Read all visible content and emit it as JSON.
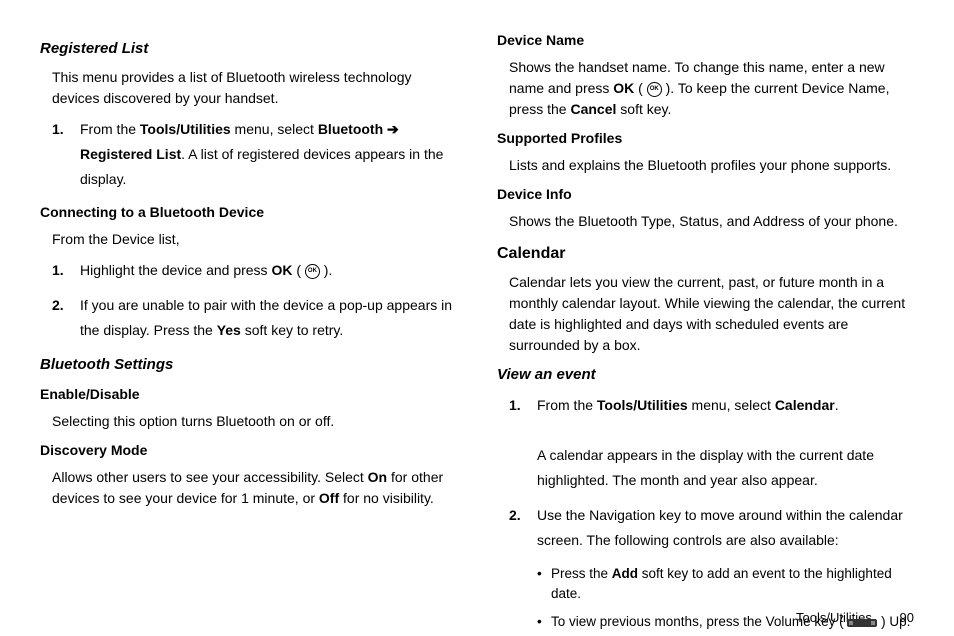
{
  "left": {
    "h1": "Registered List",
    "p1": "This menu provides a list of Bluetooth wireless technology devices discovered by your handset.",
    "list1": {
      "num": "1.",
      "pre": "From the ",
      "b1": "Tools/Utilities",
      "mid1": " menu, select ",
      "b2": "Bluetooth",
      "arrow": " ➔ ",
      "b3": "Registered List",
      "post": ". A list of registered devices appears in the display."
    },
    "h2": "Connecting to a Bluetooth Device",
    "p2": "From the Device list,",
    "list2a": {
      "num": "1.",
      "pre": "Highlight the device and press ",
      "b1": "OK",
      "mid1": " ( ",
      "post": " )."
    },
    "list2b": {
      "num": "2.",
      "pre": "If you are unable to pair with the device a pop-up appears in the display. Press the ",
      "b1": "Yes",
      "post": " soft key to retry."
    },
    "h3": "Bluetooth Settings",
    "h4": "Enable/Disable",
    "p3": "Selecting this option turns Bluetooth on or off.",
    "h5": "Discovery Mode",
    "p4pre": "Allows other users to see your accessibility. Select ",
    "p4b1": "On",
    "p4mid": " for other devices to see your device for 1 minute, or ",
    "p4b2": "Off",
    "p4post": " for no visibility."
  },
  "right": {
    "h6": "Device Name",
    "p5pre": "Shows the handset name. To change this name, enter a new name and press ",
    "p5b1": "OK",
    "p5mid1": " ( ",
    "p5mid2": " ). To keep the current Device Name, press the ",
    "p5b2": "Cancel",
    "p5post": " soft key.",
    "h7": "Supported Profiles",
    "p6": "Lists and explains the Bluetooth profiles your phone supports.",
    "h8": "Device Info",
    "p7": "Shows the Bluetooth Type, Status, and Address of your phone.",
    "h9": "Calendar",
    "p8": "Calendar lets you view the current, past, or future month in a monthly calendar layout. While viewing the calendar, the current date is highlighted and days with scheduled events are surrounded by a box.",
    "h10": "View an event",
    "list3a": {
      "num": "1.",
      "pre": "From the ",
      "b1": "Tools/Utilities",
      "mid1": " menu, select ",
      "b2": "Calendar",
      "post": ".",
      "para2": "A calendar appears in the display with the current date highlighted. The month and year also appear."
    },
    "list3b": {
      "num": "2.",
      "pre": "Use the Navigation key to move around within the calendar screen. The following controls are also available:"
    },
    "bullet1pre": "Press the ",
    "bullet1b": "Add",
    "bullet1post": " soft key to add an event to the highlighted date.",
    "bullet2pre": "To view previous months, press the Volume key ( ",
    "bullet2post": " ) Up."
  },
  "footer": {
    "section": "Tools/Utilities",
    "page": "90"
  }
}
